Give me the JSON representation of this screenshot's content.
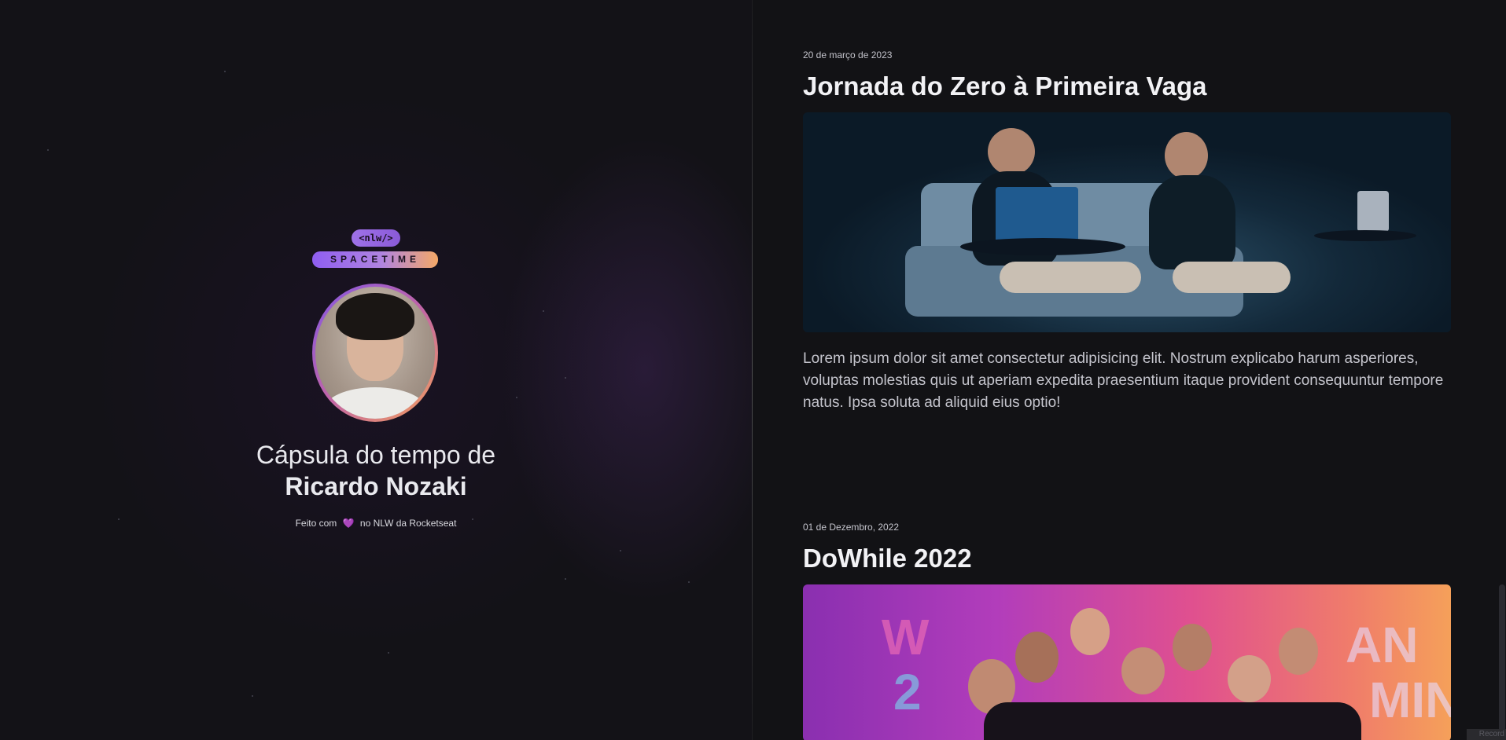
{
  "brand": {
    "logo_top": "<nlw/>",
    "logo_bar": "SPACETIME"
  },
  "hero": {
    "title_prefix": "Cápsula do tempo de",
    "title_name": "Ricardo Nozaki"
  },
  "footer": {
    "prefix": "Feito com",
    "heart": "💜",
    "suffix": "no NLW da Rocketseat"
  },
  "memories": [
    {
      "date": "20 de março de 2023",
      "title": "Jornada do Zero à Primeira Vaga",
      "text": "Lorem ipsum dolor sit amet consectetur adipisicing elit. Nostrum explicabo harum asperiores, voluptas molestias quis ut aperiam expedita praesentium itaque provident consequuntur tempore natus. Ipsa soluta ad aliquid eius optio!"
    },
    {
      "date": "01 de Dezembro, 2022",
      "title": "DoWhile 2022"
    }
  ],
  "corner": {
    "label": "Record"
  },
  "colors": {
    "background": "#121215",
    "purple": "#8257e5",
    "orange": "#f5a05a",
    "text_muted": "#c4c4cc"
  }
}
